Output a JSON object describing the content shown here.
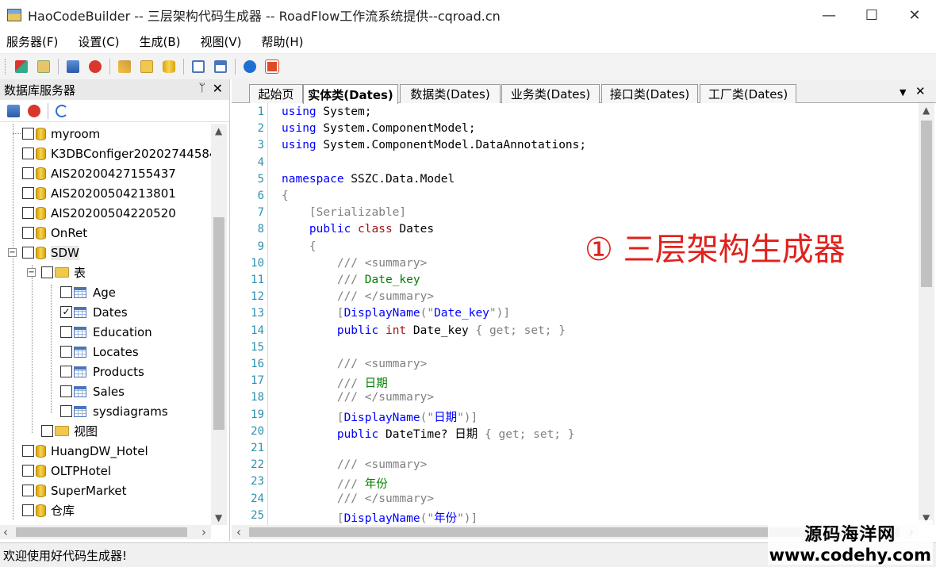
{
  "window": {
    "title": "HaoCodeBuilder -- 三层架构代码生成器 -- RoadFlow工作流系统提供--cqroad.cn",
    "minimize": "—",
    "maximize": "☐",
    "close": "✕"
  },
  "menu": [
    "服务器(F)",
    "设置(C)",
    "生成(B)",
    "视图(V)",
    "帮助(H)"
  ],
  "left_panel": {
    "title": "数据库服务器",
    "pin": "ᛘ",
    "close": "✕",
    "tree": {
      "databases_top": [
        "myroom",
        "K3DBConfiger20202744584",
        "AIS20200427155437",
        "AIS20200504213801",
        "AIS20200504220520",
        "OnRet"
      ],
      "expanded_db": "SDW",
      "tables_folder": "表",
      "tables": [
        {
          "name": "Age",
          "checked": false
        },
        {
          "name": "Dates",
          "checked": true
        },
        {
          "name": "Education",
          "checked": false
        },
        {
          "name": "Locates",
          "checked": false
        },
        {
          "name": "Products",
          "checked": false
        },
        {
          "name": "Sales",
          "checked": false
        },
        {
          "name": "sysdiagrams",
          "checked": false
        }
      ],
      "views_folder": "视图",
      "databases_bottom": [
        "HuangDW_Hotel",
        "OLTPHotel",
        "SuperMarket",
        "仓库"
      ]
    },
    "checkmark": "✓"
  },
  "tabs": [
    {
      "label": "起始页",
      "active": false
    },
    {
      "label": "实体类(Dates)",
      "active": true
    },
    {
      "label": "数据类(Dates)",
      "active": false
    },
    {
      "label": "业务类(Dates)",
      "active": false
    },
    {
      "label": "接口类(Dates)",
      "active": false
    },
    {
      "label": "工厂类(Dates)",
      "active": false
    }
  ],
  "tab_controls": {
    "dropdown": "▼",
    "close": "✕"
  },
  "code": {
    "line_numbers": [
      "1",
      "2",
      "3",
      "4",
      "5",
      "6",
      "7",
      "8",
      "9",
      "10",
      "11",
      "12",
      "13",
      "14",
      "15",
      "16",
      "17",
      "18",
      "19",
      "20",
      "21",
      "22",
      "23",
      "24",
      "25"
    ],
    "lines": [
      [
        {
          "t": "using",
          "c": "kw"
        },
        {
          "t": " System;",
          "c": ""
        }
      ],
      [
        {
          "t": "using",
          "c": "kw"
        },
        {
          "t": " System.ComponentModel;",
          "c": ""
        }
      ],
      [
        {
          "t": "using",
          "c": "kw"
        },
        {
          "t": " System.ComponentModel.DataAnnotations;",
          "c": ""
        }
      ],
      [],
      [
        {
          "t": "namespace",
          "c": "kw"
        },
        {
          "t": " SSZC.Data.Model",
          "c": ""
        }
      ],
      [
        {
          "t": "{",
          "c": "brace"
        }
      ],
      [
        {
          "t": "    [Serializable]",
          "c": "brace"
        }
      ],
      [
        {
          "t": "    ",
          "c": ""
        },
        {
          "t": "public",
          "c": "kw"
        },
        {
          "t": " ",
          "c": ""
        },
        {
          "t": "class",
          "c": "str"
        },
        {
          "t": " Dates",
          "c": ""
        }
      ],
      [
        {
          "t": "    {",
          "c": "brace"
        }
      ],
      [
        {
          "t": "        /// <summary>",
          "c": "cmtg"
        }
      ],
      [
        {
          "t": "        /// ",
          "c": "cmtg"
        },
        {
          "t": "Date_key",
          "c": "cmt"
        }
      ],
      [
        {
          "t": "        /// </summary>",
          "c": "cmtg"
        }
      ],
      [
        {
          "t": "        [",
          "c": "brace"
        },
        {
          "t": "DisplayName",
          "c": "kw"
        },
        {
          "t": "(\"",
          "c": "brace"
        },
        {
          "t": "Date_key",
          "c": "kw"
        },
        {
          "t": "\")]",
          "c": "brace"
        }
      ],
      [
        {
          "t": "        ",
          "c": ""
        },
        {
          "t": "public",
          "c": "kw"
        },
        {
          "t": " ",
          "c": ""
        },
        {
          "t": "int",
          "c": "str"
        },
        {
          "t": " Date_key ",
          "c": ""
        },
        {
          "t": "{ get; set; }",
          "c": "brace"
        }
      ],
      [],
      [
        {
          "t": "        /// <summary>",
          "c": "cmtg"
        }
      ],
      [
        {
          "t": "        /// ",
          "c": "cmtg"
        },
        {
          "t": "日期",
          "c": "cmt"
        }
      ],
      [
        {
          "t": "        /// </summary>",
          "c": "cmtg"
        }
      ],
      [
        {
          "t": "        [",
          "c": "brace"
        },
        {
          "t": "DisplayName",
          "c": "kw"
        },
        {
          "t": "(\"",
          "c": "brace"
        },
        {
          "t": "日期",
          "c": "kw"
        },
        {
          "t": "\")]",
          "c": "brace"
        }
      ],
      [
        {
          "t": "        ",
          "c": ""
        },
        {
          "t": "public",
          "c": "kw"
        },
        {
          "t": " DateTime? 日期 ",
          "c": ""
        },
        {
          "t": "{ get; set; }",
          "c": "brace"
        }
      ],
      [],
      [
        {
          "t": "        /// <summary>",
          "c": "cmtg"
        }
      ],
      [
        {
          "t": "        /// ",
          "c": "cmtg"
        },
        {
          "t": "年份",
          "c": "cmt"
        }
      ],
      [
        {
          "t": "        /// </summary>",
          "c": "cmtg"
        }
      ],
      [
        {
          "t": "        [",
          "c": "brace"
        },
        {
          "t": "DisplayName",
          "c": "kw"
        },
        {
          "t": "(\"",
          "c": "brace"
        },
        {
          "t": "年份",
          "c": "kw"
        },
        {
          "t": "\")]",
          "c": "brace"
        }
      ]
    ]
  },
  "overlay": "① 三层架构生成器",
  "status": "欢迎使用好代码生成器!",
  "watermark": {
    "line1": "源码海洋网",
    "line2": "www.codehy.com"
  },
  "scroll_arrows": {
    "up": "▲",
    "down": "▼",
    "left": "‹",
    "right": "›"
  },
  "colors": {
    "accent_red": "#e0211c",
    "keyword": "#0000ff",
    "comment": "#008000",
    "line_number": "#2b91af"
  }
}
